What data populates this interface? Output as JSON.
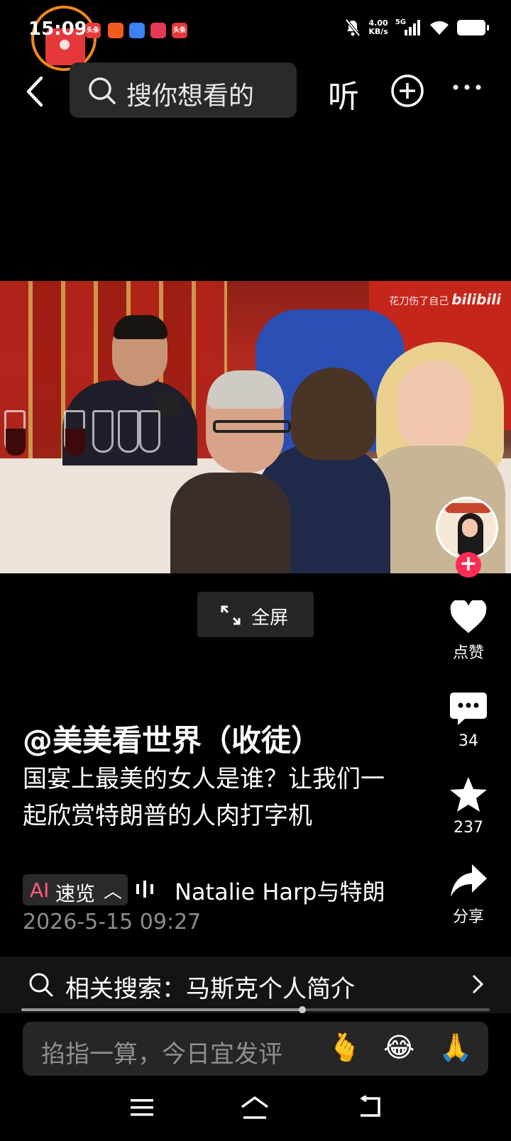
{
  "status_bar": {
    "time": "15:09",
    "notification_icons": [
      "头条",
      "app",
      "app",
      "app",
      "头条"
    ],
    "net_speed_value": "4.00",
    "net_speed_unit": "KB/s",
    "signal_label": "5G"
  },
  "top_nav": {
    "search_placeholder": "搜你想看的",
    "listen_label": "听"
  },
  "video": {
    "watermark_text": "花刀伤了自己",
    "watermark_brand": "bilibili",
    "fullscreen_label": "全屏"
  },
  "actions": {
    "like_label": "点赞",
    "comment_count": "34",
    "favorite_count": "237",
    "share_label": "分享"
  },
  "post": {
    "author": "@美美看世界（收徒）",
    "caption": "国宴上最美的女人是谁？让我们一起欣赏特朗普的人肉打字机",
    "ai_brief_label": "速览",
    "ai_badge": "AI",
    "ai_summary": "Natalie Harp与特朗",
    "date": "2026-5-15 09:27"
  },
  "related_search": {
    "text": "相关搜索：马斯克个人简介",
    "progress": 0.6
  },
  "comment_box": {
    "placeholder": "掐指一算，今日宜发评",
    "emojis": [
      "🫰",
      "😂",
      "🙏"
    ]
  }
}
